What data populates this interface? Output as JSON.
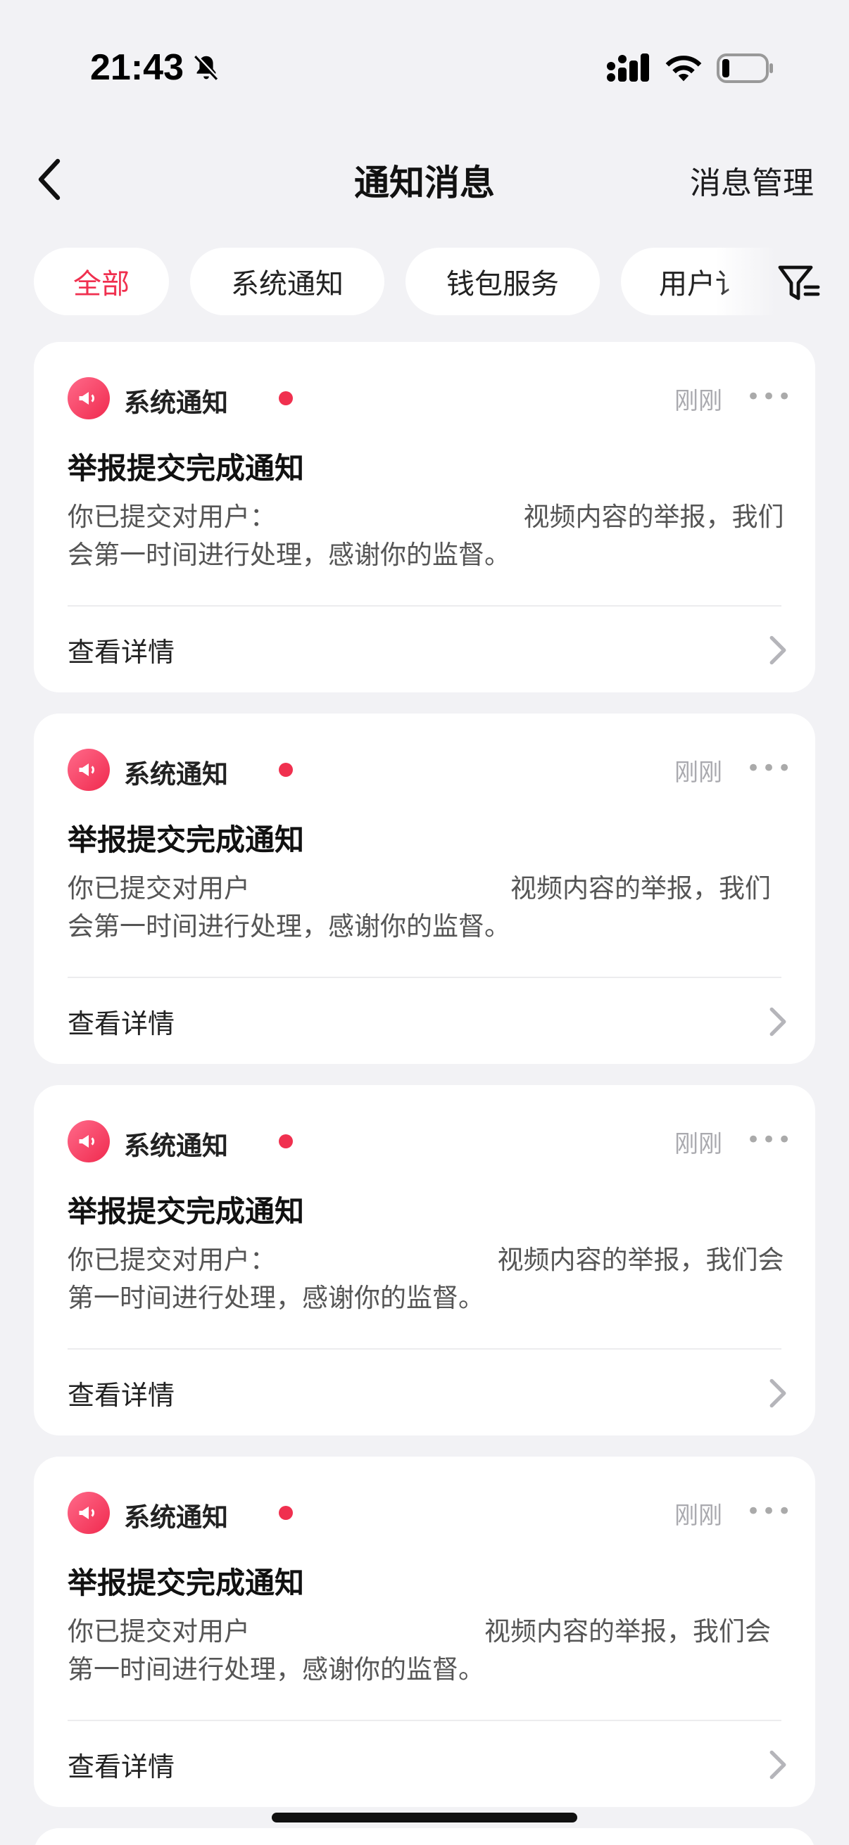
{
  "status_bar": {
    "time": "21:43"
  },
  "nav": {
    "title": "通知消息",
    "action": "消息管理"
  },
  "tabs": [
    {
      "label": "全部",
      "active": true
    },
    {
      "label": "系统通知",
      "active": false
    },
    {
      "label": "钱包服务",
      "active": false
    },
    {
      "label": "用户讠",
      "active": false
    }
  ],
  "notifications": [
    {
      "source": "系统通知",
      "time": "刚刚",
      "title": "举报提交完成通知",
      "body": "你已提交对用户：　　　　　　　　　　视频内容的举报，我们会第一时间进行处理，感谢你的监督。",
      "action": "查看详情",
      "unread": true
    },
    {
      "source": "系统通知",
      "time": "刚刚",
      "title": "举报提交完成通知",
      "body": "你已提交对用户　　　　　　　　　　视频内容的举报，我们会第一时间进行处理，感谢你的监督。",
      "action": "查看详情",
      "unread": true
    },
    {
      "source": "系统通知",
      "time": "刚刚",
      "title": "举报提交完成通知",
      "body": "你已提交对用户：　　　　　　　　　视频内容的举报，我们会第一时间进行处理，感谢你的监督。",
      "action": "查看详情",
      "unread": true
    },
    {
      "source": "系统通知",
      "time": "刚刚",
      "title": "举报提交完成通知",
      "body": "你已提交对用户　　　　　　　　　视频内容的举报，我们会第一时间进行处理，感谢你的监督。",
      "action": "查看详情",
      "unread": true
    }
  ],
  "colors": {
    "accent": "#f0304f",
    "background": "#f2f2f5",
    "card": "#ffffff"
  }
}
